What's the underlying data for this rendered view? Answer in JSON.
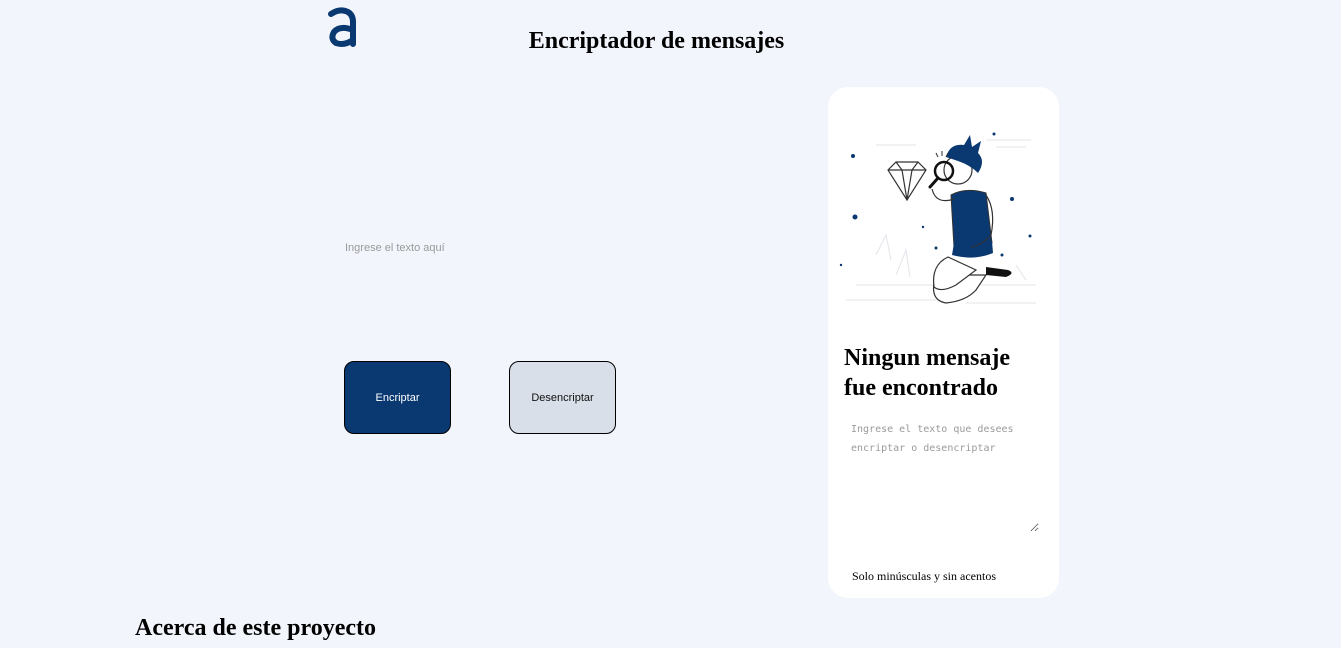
{
  "header": {
    "logo_icon": "alura-logo-icon",
    "title": "Encriptador de mensajes"
  },
  "editor": {
    "input_placeholder": "Ingrese el texto aquí",
    "input_value": "",
    "encrypt_label": "Encriptar",
    "decrypt_label": "Desencriptar"
  },
  "result_panel": {
    "illustration": "person-with-magnifier-looking-at-diamond-illustration",
    "title": "Ningun mensaje fue encontrado",
    "output_placeholder": "Ingrese el texto que desees encriptar o desencriptar",
    "output_value": "",
    "note": "Solo minúsculas y sin acentos"
  },
  "about": {
    "heading": "Acerca de este proyecto"
  },
  "colors": {
    "background": "#F3F5FC",
    "primary": "#0A3871",
    "secondary_button": "#D8DFE8",
    "card": "#FFFFFF"
  }
}
